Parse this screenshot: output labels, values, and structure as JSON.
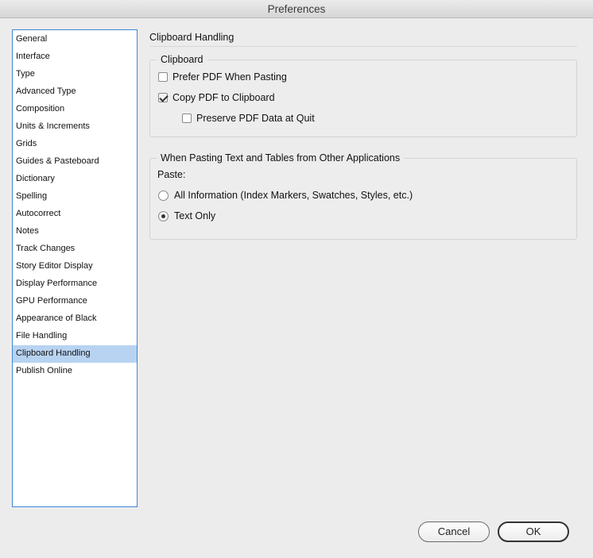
{
  "window": {
    "title": "Preferences"
  },
  "sidebar": {
    "items": [
      {
        "label": "General"
      },
      {
        "label": "Interface"
      },
      {
        "label": "Type"
      },
      {
        "label": "Advanced Type"
      },
      {
        "label": "Composition"
      },
      {
        "label": "Units & Increments"
      },
      {
        "label": "Grids"
      },
      {
        "label": "Guides & Pasteboard"
      },
      {
        "label": "Dictionary"
      },
      {
        "label": "Spelling"
      },
      {
        "label": "Autocorrect"
      },
      {
        "label": "Notes"
      },
      {
        "label": "Track Changes"
      },
      {
        "label": "Story Editor Display"
      },
      {
        "label": "Display Performance"
      },
      {
        "label": "GPU Performance"
      },
      {
        "label": "Appearance of Black"
      },
      {
        "label": "File Handling"
      },
      {
        "label": "Clipboard Handling"
      },
      {
        "label": "Publish Online"
      }
    ],
    "selected": "Clipboard Handling"
  },
  "main": {
    "title": "Clipboard Handling",
    "clipboard_group": {
      "legend": "Clipboard",
      "options": [
        {
          "label": "Prefer PDF When Pasting",
          "checked": false
        },
        {
          "label": "Copy PDF to Clipboard",
          "checked": true
        },
        {
          "label": "Preserve PDF Data at Quit",
          "checked": false
        }
      ]
    },
    "paste_group": {
      "legend": "When Pasting Text and Tables from Other Applications",
      "paste_label": "Paste:",
      "options": [
        {
          "label": "All Information (Index Markers, Swatches, Styles, etc.)",
          "selected": false
        },
        {
          "label": "Text Only",
          "selected": true
        }
      ]
    }
  },
  "buttons": {
    "cancel": "Cancel",
    "ok": "OK"
  }
}
